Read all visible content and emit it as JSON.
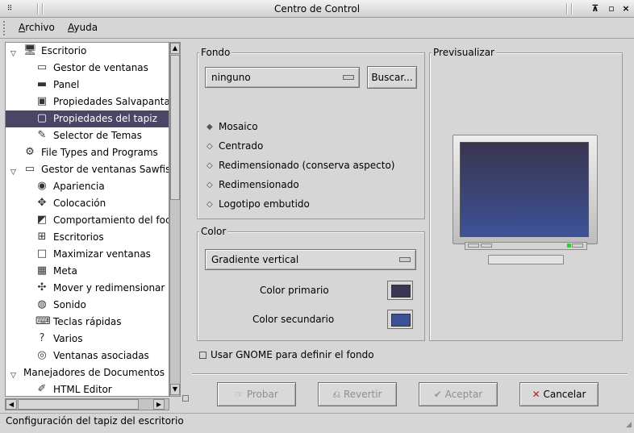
{
  "window": {
    "title": "Centro de Control",
    "controls": [
      "⊼",
      "▫",
      "×"
    ]
  },
  "menubar": {
    "items": [
      "Archivo",
      "Ayuda"
    ]
  },
  "tree": {
    "items": [
      {
        "label": "Escritorio",
        "level": 0,
        "expanded": true,
        "icon": "desktop-icon",
        "glyph": "🖥"
      },
      {
        "label": "Gestor de ventanas",
        "level": 1,
        "icon": "window-manager-icon",
        "glyph": "▭"
      },
      {
        "label": "Panel",
        "level": 1,
        "icon": "panel-icon",
        "glyph": "▬"
      },
      {
        "label": "Propiedades Salvapanta",
        "level": 1,
        "icon": "screensaver-icon",
        "glyph": "▣"
      },
      {
        "label": "Propiedades del tapiz",
        "level": 1,
        "icon": "background-icon",
        "glyph": "▢",
        "selected": true
      },
      {
        "label": "Selector de Temas",
        "level": 1,
        "icon": "theme-icon",
        "glyph": "✎"
      },
      {
        "label": "File Types and Programs",
        "level": 0,
        "icon": "file-types-icon",
        "glyph": "⚙"
      },
      {
        "label": "Gestor de ventanas Sawfish",
        "level": 0,
        "expanded": true,
        "icon": "sawfish-icon",
        "glyph": "▭"
      },
      {
        "label": "Apariencia",
        "level": 1,
        "icon": "eye-icon",
        "glyph": "◉"
      },
      {
        "label": "Colocación",
        "level": 1,
        "icon": "placement-icon",
        "glyph": "✥"
      },
      {
        "label": "Comportamiento del foco",
        "level": 1,
        "icon": "focus-icon",
        "glyph": "◩"
      },
      {
        "label": "Escritorios",
        "level": 1,
        "icon": "workspaces-icon",
        "glyph": "⊞"
      },
      {
        "label": "Maximizar ventanas",
        "level": 1,
        "icon": "maximize-icon",
        "glyph": "□"
      },
      {
        "label": "Meta",
        "level": 1,
        "icon": "meta-icon",
        "glyph": "▦"
      },
      {
        "label": "Mover y redimensionar",
        "level": 1,
        "icon": "move-resize-icon",
        "glyph": "✣"
      },
      {
        "label": "Sonido",
        "level": 1,
        "icon": "drum-icon",
        "glyph": "◍"
      },
      {
        "label": "Teclas rápidas",
        "level": 1,
        "icon": "keyboard-icon",
        "glyph": "⌨"
      },
      {
        "label": "Varios",
        "level": 1,
        "icon": "question-icon",
        "glyph": "?"
      },
      {
        "label": "Ventanas asociadas",
        "level": 1,
        "icon": "associated-windows-icon",
        "glyph": "◎"
      },
      {
        "label": "Manejadores de Documentos",
        "level": 0,
        "expanded": true,
        "icon": "",
        "glyph": ""
      },
      {
        "label": "HTML Editor",
        "level": 1,
        "icon": "html-editor-icon",
        "glyph": "✐"
      }
    ]
  },
  "fondo": {
    "label": "Fondo",
    "image_value": "ninguno",
    "browse_label": "Buscar...",
    "options": [
      {
        "label": "Mosaico",
        "checked": true
      },
      {
        "label": "Centrado",
        "checked": false
      },
      {
        "label": "Redimensionado (conserva aspecto)",
        "checked": false
      },
      {
        "label": "Redimensionado",
        "checked": false
      },
      {
        "label": "Logotipo embutido",
        "checked": false
      }
    ]
  },
  "color": {
    "label": "Color",
    "type_value": "Gradiente vertical",
    "primary_label": "Color primario",
    "primary_color": "#3a3550",
    "secondary_label": "Color secundario",
    "secondary_color": "#3d5296"
  },
  "preview": {
    "label": "Previsualizar",
    "top_color": "#3a3550",
    "bottom_color": "#3d5296"
  },
  "gnome_checkbox": {
    "label": "Usar GNOME para definir el fondo",
    "checked": false
  },
  "buttons": {
    "try": "Probar",
    "revert": "Revertir",
    "accept": "Aceptar",
    "cancel": "Cancelar"
  },
  "status": {
    "text": "Configuración del tapiz del escritorio"
  }
}
